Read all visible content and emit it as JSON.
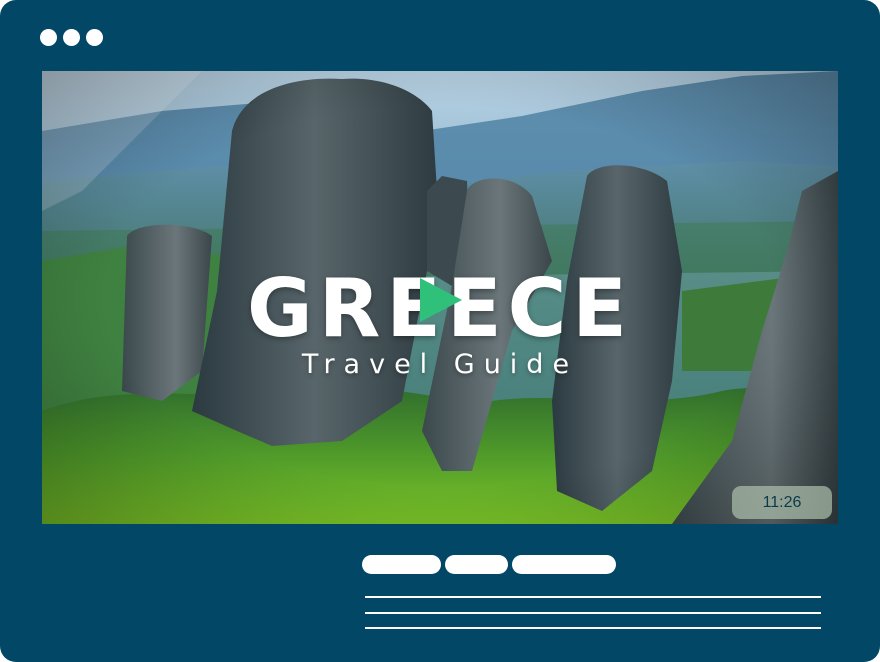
{
  "window": {
    "background_color": "#024866",
    "controls": [
      "dot",
      "dot",
      "dot"
    ]
  },
  "video": {
    "title": "GREECE",
    "subtitle": "Travel Guide",
    "duration": "11:26",
    "play_icon": "play-icon",
    "accent_color": "#2fc07a"
  },
  "placeholder": {
    "pill_count": 3,
    "line_count": 3
  }
}
